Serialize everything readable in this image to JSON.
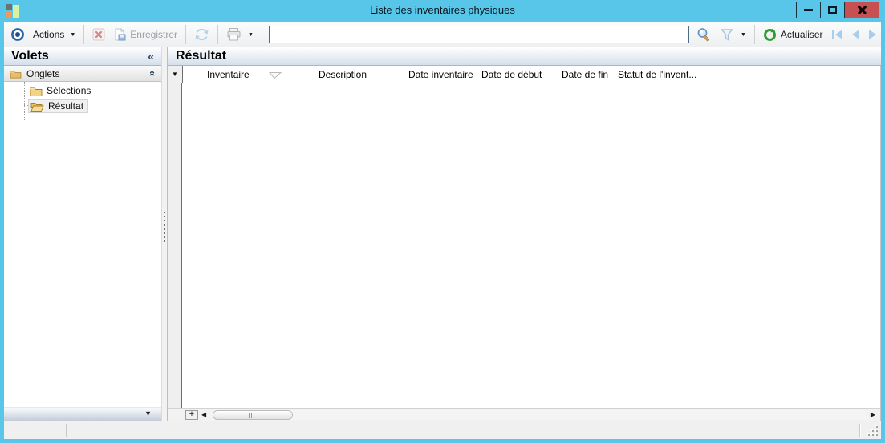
{
  "window": {
    "title": "Liste des inventaires physiques"
  },
  "toolbar": {
    "actions_label": "Actions",
    "delete": {
      "enabled": false
    },
    "save": {
      "label": "Enregistrer",
      "enabled": false
    },
    "refresh_icon": {
      "enabled": false
    },
    "print": {
      "enabled": false
    },
    "search_value": "",
    "refresh_label": "Actualiser"
  },
  "sidebar": {
    "title": "Volets",
    "group_label": "Onglets",
    "items": [
      {
        "label": "Sélections",
        "selected": false
      },
      {
        "label": "Résultat",
        "selected": true
      }
    ]
  },
  "main": {
    "title": "Résultat",
    "table": {
      "columns": [
        "Inventaire",
        "Description",
        "Date inventaire",
        "Date de début",
        "Date de fin",
        "Statut de l'invent..."
      ],
      "rows": []
    }
  },
  "glyphs": {
    "collapse_left": "«",
    "collapse_up": "«",
    "dropdown": "▼",
    "scroll_left": "◀",
    "scroll_right": "▶",
    "scroll_down": "▼",
    "plus": "+"
  },
  "colors": {
    "titlebar": "#57c6e8",
    "close_button": "#c75050",
    "accent_blue": "#2a64a8",
    "refresh_green": "#2f9e33",
    "nav_arrow_blue": "#a9cdec"
  }
}
